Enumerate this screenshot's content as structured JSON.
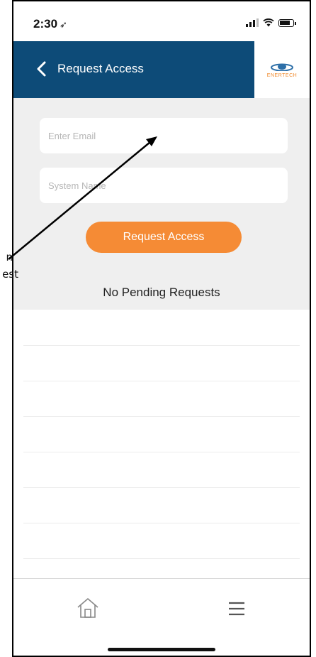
{
  "status_bar": {
    "time": "2:30",
    "location_glyph": "➶"
  },
  "header": {
    "title": "Request Access",
    "logo_text": "ENERTECH",
    "bg_color": "#0d4b78"
  },
  "form": {
    "email_placeholder": "Enter Email",
    "system_placeholder": "System Name",
    "submit_label": "Request Access",
    "accent_color": "#f58b35"
  },
  "status_message": "No Pending Requests",
  "tab_bar": {
    "home_icon": "home-icon",
    "menu_icon": "menu-icon"
  },
  "annotation": {
    "line1": "n",
    "line2": "est"
  }
}
